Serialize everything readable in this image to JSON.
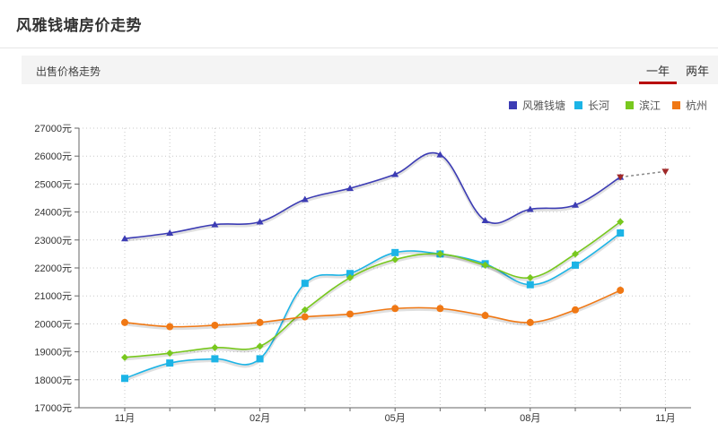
{
  "header": {
    "title": "风雅钱塘房价走势"
  },
  "subheader": {
    "label": "出售价格走势",
    "tabs": [
      {
        "label": "一年",
        "active": true
      },
      {
        "label": "两年",
        "active": false
      }
    ]
  },
  "colors": {
    "accent": "#b80000",
    "grid": "#c8c8c8",
    "axis": "#666666",
    "forecast": "#a02828"
  },
  "chart_data": {
    "type": "line",
    "title": "",
    "xlabel": "",
    "ylabel": "",
    "ylim": [
      17000,
      27000
    ],
    "y_ticks": [
      17000,
      18000,
      19000,
      20000,
      21000,
      22000,
      23000,
      24000,
      25000,
      26000,
      27000
    ],
    "y_tick_suffix": "元",
    "x_ticks": [
      {
        "label": "11月",
        "index": 0
      },
      {
        "label": "02月",
        "index": 3
      },
      {
        "label": "05月",
        "index": 6
      },
      {
        "label": "08月",
        "index": 9
      },
      {
        "label": "11月",
        "index": 12
      }
    ],
    "x_count": 13,
    "grid": true,
    "legend_position": "top-right",
    "series": [
      {
        "name": "风雅钱塘",
        "color": "#3c3cb4",
        "marker": "triangle",
        "values": [
          23050,
          23250,
          23550,
          23650,
          24450,
          24850,
          25350,
          26050,
          23700,
          24100,
          24250,
          25250
        ],
        "forecast": [
          25250,
          25450
        ]
      },
      {
        "name": "长河",
        "color": "#1cb4e6",
        "marker": "square",
        "values": [
          18050,
          18600,
          18750,
          18750,
          21450,
          21800,
          22550,
          22500,
          22150,
          21400,
          22100,
          23250
        ]
      },
      {
        "name": "滨江",
        "color": "#78c81e",
        "marker": "diamond",
        "values": [
          18800,
          18950,
          19150,
          19200,
          20500,
          21650,
          22300,
          22500,
          22100,
          21650,
          22500,
          23650
        ]
      },
      {
        "name": "杭州",
        "color": "#f07814",
        "marker": "circle",
        "values": [
          20050,
          19900,
          19950,
          20050,
          20250,
          20350,
          20550,
          20550,
          20300,
          20050,
          20500,
          21200
        ]
      }
    ]
  }
}
